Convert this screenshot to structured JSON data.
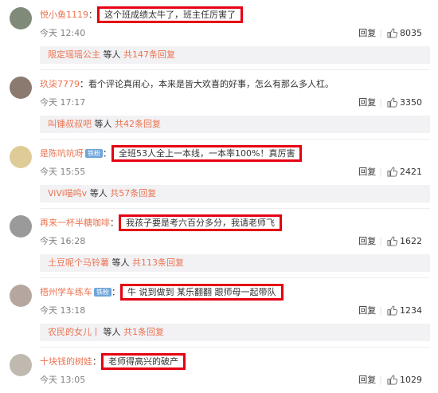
{
  "actions": {
    "reply_label": "回复"
  },
  "comments": [
    {
      "user": "悦小鱼1119",
      "colon": "：",
      "text": "这个班成绩太牛了，班主任厉害了",
      "time": "今天 12:40",
      "likes": "8035",
      "reply_user": "限定瑶瑶公主",
      "reply_mid": " 等人 ",
      "reply_more": "共147条回复",
      "avatar_color": "#7f8a79"
    },
    {
      "user": "玖柒7779",
      "colon": "：",
      "text": "看个评论真闹心，本来是皆大欢喜的好事，怎么有那么多人杠。",
      "time": "今天 17:17",
      "likes": "3350",
      "reply_user": "叫锤叔叔吧",
      "reply_mid": " 等人 ",
      "reply_more": "共42条回复",
      "avatar_color": "#8b7a70"
    },
    {
      "user": "是陈吭吭呀",
      "badge": "铁粉",
      "colon": "：",
      "text": "全班53人全上一本线，一本率100%！真厉害",
      "time": "今天 15:55",
      "likes": "2421",
      "reply_user": "ViVi喵呜v",
      "reply_mid": " 等人 ",
      "reply_more": "共57条回复",
      "avatar_color": "#dfcb98"
    },
    {
      "user": "再来一杯半糖咖啡",
      "colon": "：",
      "text": "我孩子要是考六百分多分，我请老师飞",
      "time": "今天 16:28",
      "likes": "1622",
      "reply_user": "土豆呢个马铃薯",
      "reply_mid": " 等人 ",
      "reply_more": "共113条回复",
      "avatar_color": "#9a9a9a"
    },
    {
      "user": "梧州学车练车",
      "badge": "铁粉",
      "colon": "：",
      "text": "牛 说到做到 某乐翻翻 跟师母一起带队",
      "time": "今天 13:18",
      "likes": "1234",
      "reply_user": "农民的女儿丨",
      "reply_mid": " 等人 ",
      "reply_more": "共1条回复",
      "avatar_color": "#b5a7a0"
    },
    {
      "user": "十块钱的树娃",
      "colon": "：",
      "text": "老师得高兴的破产",
      "time": "今天 13:05",
      "likes": "1029",
      "avatar_color": "#c0b9b0"
    }
  ]
}
